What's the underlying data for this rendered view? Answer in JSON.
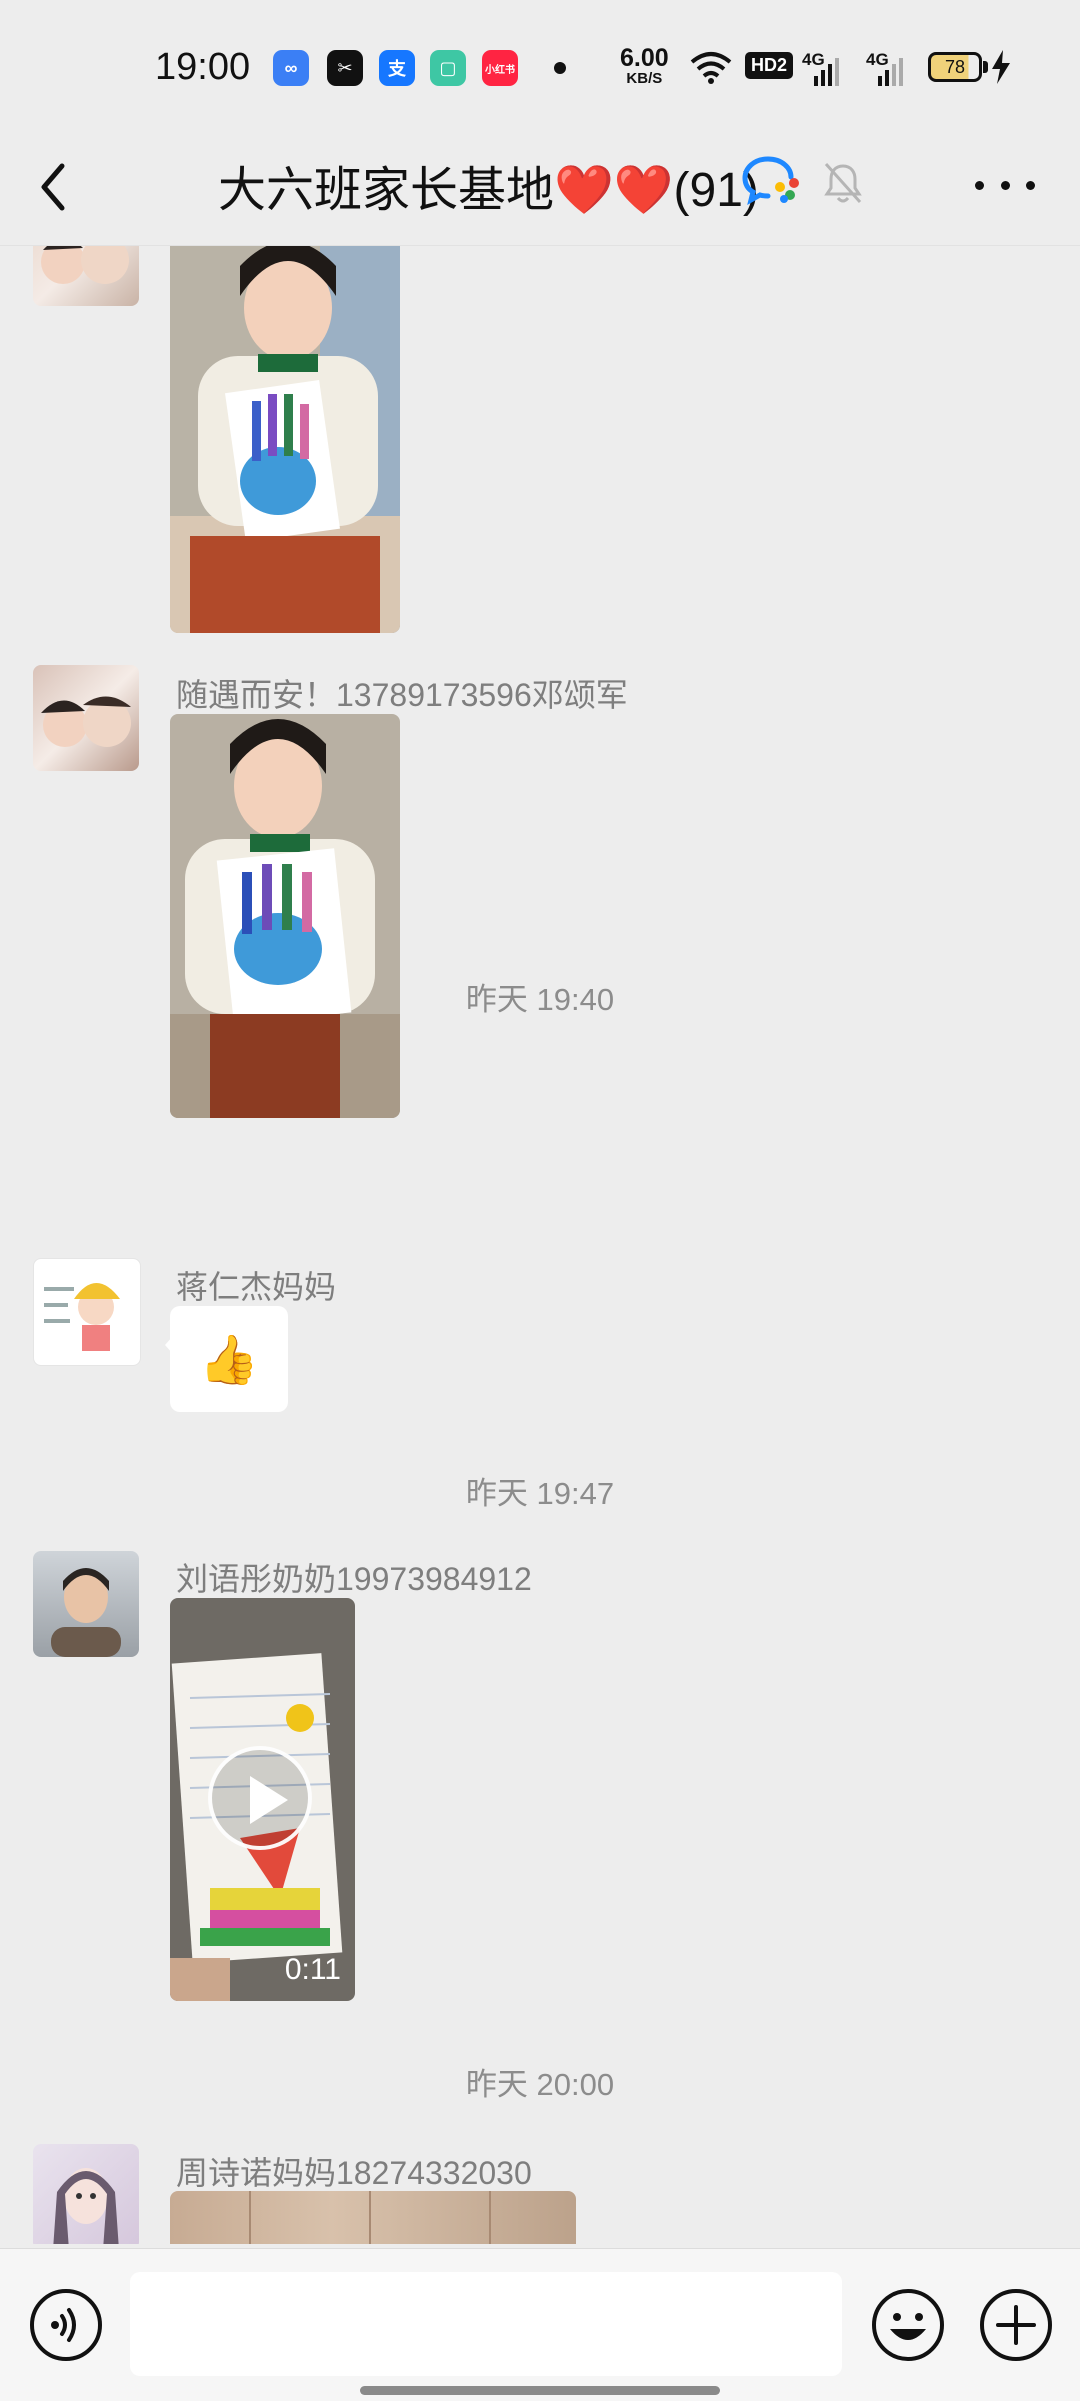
{
  "status_bar": {
    "time": "19:00",
    "app_icons": [
      {
        "name": "shortvideo-app-icon",
        "color": "#3b7ff5",
        "glyph": "∞"
      },
      {
        "name": "capcut-app-icon",
        "color": "#111111",
        "glyph": "✂"
      },
      {
        "name": "alipay-app-icon",
        "color": "#1677ff",
        "glyph": "支"
      },
      {
        "name": "notes-app-icon",
        "color": "#3ec7a4",
        "glyph": "▢"
      },
      {
        "name": "xiaohongshu-app-icon",
        "color": "#ff2442",
        "glyph": "小红书"
      }
    ],
    "net_speed_value": "6.00",
    "net_speed_unit": "KB/S",
    "hd_label": "HD2",
    "sim1_label": "4G",
    "sim2_label": "4G",
    "battery_level": "78"
  },
  "header": {
    "title": "大六班家长基地",
    "hearts": "❤️❤️",
    "member_count": "(91)"
  },
  "messages": [
    {
      "type": "image",
      "sender": "",
      "description_icon": "photo"
    },
    {
      "type": "image",
      "sender": "随遇而安！13789173596邓颂军"
    },
    {
      "type": "time",
      "text": "昨天 19:40"
    },
    {
      "type": "emoji",
      "sender": "蒋仁杰妈妈",
      "content": "👍"
    },
    {
      "type": "time",
      "text": "昨天 19:47"
    },
    {
      "type": "video",
      "sender": "刘语彤奶奶19973984912",
      "duration": "0:11"
    },
    {
      "type": "time",
      "text": "昨天 20:00"
    },
    {
      "type": "image",
      "sender": "周诗诺妈妈18274332030"
    }
  ],
  "input": {
    "placeholder": "",
    "value": ""
  },
  "colors": {
    "background": "#ededed",
    "bubble": "#ffffff",
    "input_bar": "#f6f6f6"
  }
}
